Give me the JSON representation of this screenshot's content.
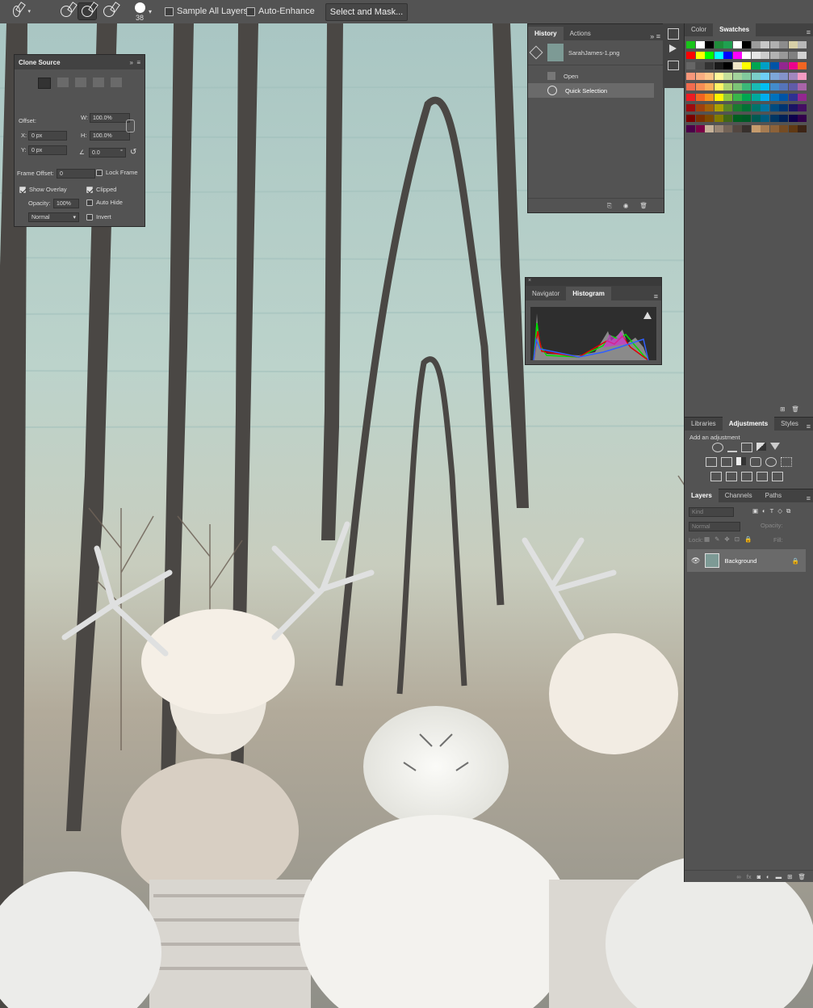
{
  "options_bar": {
    "brush_size": "38",
    "sample_all_layers_label": "Sample All Layers",
    "sample_all_layers_checked": false,
    "auto_enhance_label": "Auto-Enhance",
    "auto_enhance_checked": false,
    "select_and_mask_label": "Select and Mask..."
  },
  "clone_source": {
    "title": "Clone Source",
    "offset_label": "Offset:",
    "w_label": "W:",
    "w_value": "100.0%",
    "h_label": "H:",
    "h_value": "100.0%",
    "x_label": "X:",
    "x_value": "0 px",
    "y_label": "Y:",
    "y_value": "0 px",
    "angle_value": "0.0",
    "angle_unit": "°",
    "frame_offset_label": "Frame Offset:",
    "frame_offset_value": "0",
    "lock_frame_label": "Lock Frame",
    "show_overlay_label": "Show Overlay",
    "clipped_label": "Clipped",
    "opacity_label": "Opacity:",
    "opacity_value": "100%",
    "auto_hide_label": "Auto Hide",
    "blend_mode": "Normal",
    "invert_label": "Invert"
  },
  "history": {
    "tabs": [
      "History",
      "Actions"
    ],
    "snapshot_name": "SarahJames-1.png",
    "states": [
      "Open",
      "Quick Selection"
    ]
  },
  "navigator": {
    "tabs": [
      "Navigator",
      "Histogram"
    ]
  },
  "swatches": {
    "tabs": [
      "Color",
      "Swatches"
    ],
    "colors": [
      [
        "#19c419",
        "#ffffff",
        "#000000",
        "#1f8c3a",
        "#20a050",
        "#ffffff",
        "#000000",
        "#9c9c9c",
        "#c8c8c8",
        "#b0b0b0",
        "#8c8c8c",
        "#d8d0a8",
        "#b8b8b8"
      ],
      [
        "#ff0000",
        "#ffff00",
        "#00ff00",
        "#00ffff",
        "#0000ff",
        "#ff00ff",
        "#ffffff",
        "#e6e6e6",
        "#cccccc",
        "#b3b3b3",
        "#999999",
        "#808080",
        "#d2d2d2"
      ],
      [
        "#666666",
        "#4d4d4d",
        "#333333",
        "#1a1a1a",
        "#000000",
        "#f0e6c8",
        "#ffff00",
        "#00a651",
        "#00a0c6",
        "#0054a6",
        "#92278f",
        "#ec008c",
        "#f26522"
      ],
      [
        "#f7977a",
        "#f9ad81",
        "#fdc68a",
        "#fff79a",
        "#c4df9b",
        "#a3d39c",
        "#82ca9d",
        "#7bcdc8",
        "#6ecff6",
        "#7ea7d8",
        "#8493ca",
        "#a187be",
        "#f49ac2"
      ],
      [
        "#f26c4f",
        "#f68e55",
        "#fbaf5c",
        "#fff467",
        "#acd372",
        "#7cc576",
        "#3bb878",
        "#1abbb4",
        "#00bff3",
        "#438ccb",
        "#5574b9",
        "#605ca8",
        "#a864a8"
      ],
      [
        "#ed1c24",
        "#f26522",
        "#f7941d",
        "#fff200",
        "#8dc73f",
        "#39b54a",
        "#00a651",
        "#00a99d",
        "#00aeef",
        "#0072bc",
        "#0054a6",
        "#2e3192",
        "#92278f"
      ],
      [
        "#9e0b0f",
        "#a0410d",
        "#a36209",
        "#aba000",
        "#598527",
        "#1a7b30",
        "#007236",
        "#00746b",
        "#0076a3",
        "#004b80",
        "#003471",
        "#1b1464",
        "#440e62"
      ],
      [
        "#790000",
        "#7b2e00",
        "#7d4900",
        "#827b00",
        "#406618",
        "#005e20",
        "#005826",
        "#005952",
        "#005b7f",
        "#003663",
        "#002157",
        "#0d004c",
        "#32004b"
      ],
      [
        "#4b0049",
        "#7b0046",
        "#c7b299",
        "#998675",
        "#736357",
        "#534741",
        "#37302d",
        "#c69c6d",
        "#a67c52",
        "#8c6239",
        "#754c24",
        "#603913",
        "#3c2415"
      ]
    ]
  },
  "adjustments": {
    "tabs": [
      "Libraries",
      "Adjustments",
      "Styles"
    ],
    "add_label": "Add an adjustment"
  },
  "layers": {
    "tabs": [
      "Layers",
      "Channels",
      "Paths"
    ],
    "kind_placeholder": "Kind",
    "blend_mode": "Normal",
    "opacity_label": "Opacity:",
    "lock_label": "Lock:",
    "fill_label": "Fill:",
    "layer_name": "Background"
  }
}
